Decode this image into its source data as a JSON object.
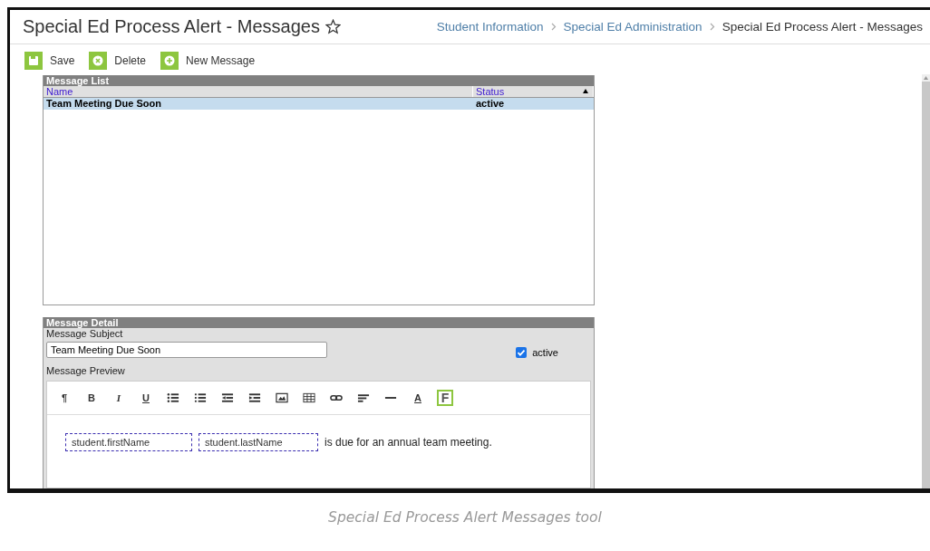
{
  "page": {
    "title": "Special Ed Process Alert - Messages",
    "favorite": false,
    "breadcrumb": [
      {
        "label": "Student Information",
        "link": true
      },
      {
        "label": "Special Ed Administration",
        "link": true
      },
      {
        "label": "Special Ed Process Alert - Messages",
        "link": false
      }
    ]
  },
  "toolbar": [
    {
      "label": "Save",
      "kind": "save"
    },
    {
      "label": "Delete",
      "kind": "delete"
    },
    {
      "label": "New Message",
      "kind": "add"
    }
  ],
  "message_list": {
    "title": "Message List",
    "columns": [
      {
        "label": "Name",
        "sorted": false
      },
      {
        "label": "Status",
        "sorted": true
      }
    ],
    "rows": [
      {
        "name": "Team Meeting Due Soon",
        "status": "active",
        "selected": true
      }
    ]
  },
  "message_detail": {
    "title": "Message Detail",
    "subject_label": "Message Subject",
    "subject_value": "Team Meeting Due Soon",
    "active_label": "active",
    "active_checked": true,
    "preview_label": "Message Preview",
    "editor_tools": [
      {
        "kind": "glyph",
        "glyph": "¶",
        "active": false
      },
      {
        "kind": "glyph",
        "glyph": "B",
        "active": false
      },
      {
        "kind": "glyph",
        "glyph": "I",
        "active": false
      },
      {
        "kind": "glyph",
        "glyph": "U",
        "active": false
      },
      {
        "kind": "bullets",
        "active": false
      },
      {
        "kind": "numbers",
        "active": false
      },
      {
        "kind": "outdent",
        "active": false
      },
      {
        "kind": "indent",
        "active": false
      },
      {
        "kind": "image",
        "active": false
      },
      {
        "kind": "table",
        "active": false
      },
      {
        "kind": "link",
        "active": false
      },
      {
        "kind": "align",
        "active": false
      },
      {
        "kind": "rule",
        "active": false
      },
      {
        "kind": "glyph",
        "glyph": "A",
        "active": false
      },
      {
        "kind": "glyph",
        "glyph": "F",
        "active": true
      }
    ],
    "fields": [
      "student.firstName",
      "student.lastName"
    ],
    "body_text": "is due for an annual team meeting."
  },
  "caption": "Special Ed Process Alert Messages tool"
}
